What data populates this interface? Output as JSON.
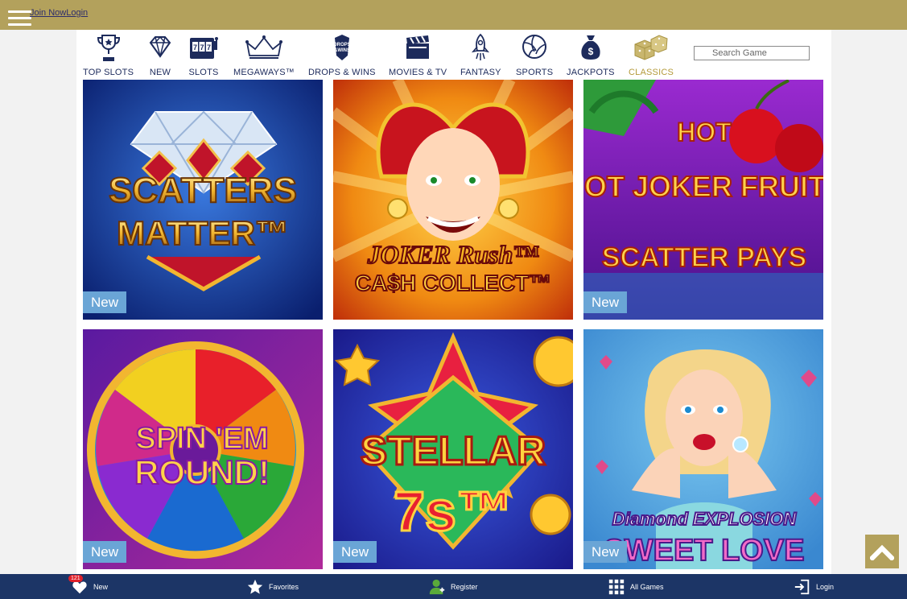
{
  "header": {
    "join_label": "Join Now",
    "login_label": "Login"
  },
  "categories": [
    {
      "label": "TOP SLOTS",
      "icon": "trophy-icon",
      "active": false
    },
    {
      "label": "NEW",
      "icon": "diamond-icon",
      "active": false
    },
    {
      "label": "SLOTS",
      "icon": "slot-machine-icon",
      "active": false
    },
    {
      "label": "MEGAWAYS™",
      "icon": "crown-icon",
      "active": false
    },
    {
      "label": "DROPS & WINS",
      "icon": "drops-wins-icon",
      "active": false
    },
    {
      "label": "MOVIES & TV",
      "icon": "clapperboard-icon",
      "active": false
    },
    {
      "label": "FANTASY",
      "icon": "rocket-icon",
      "active": false
    },
    {
      "label": "SPORTS",
      "icon": "volleyball-icon",
      "active": false
    },
    {
      "label": "JACKPOTS",
      "icon": "money-bag-icon",
      "active": false
    },
    {
      "label": "CLASSICS",
      "icon": "dice-icon",
      "active": true
    }
  ],
  "search": {
    "placeholder": "Search Game"
  },
  "games": [
    {
      "title_line1": "SCATTERS",
      "title_line2": "MATTER™",
      "badge": "New"
    },
    {
      "title_line1": "JOKER Rush™",
      "title_line2": "CA$H COLLECT™",
      "badge": ""
    },
    {
      "title_line1": "HOT JOKER FRUITS",
      "title_line2": "SCATTER PAYS",
      "badge": "New"
    },
    {
      "title_line1": "SPIN 'EM",
      "title_line2": "ROUND!",
      "badge": "New"
    },
    {
      "title_line1": "STELLAR",
      "title_line2": "7s™",
      "badge": "New"
    },
    {
      "title_line1": "Diamond EXPLOSION",
      "title_line2": "SWEET LOVE",
      "badge": "New"
    }
  ],
  "bottom_nav": [
    {
      "label": "New",
      "icon": "heart-tag-icon",
      "count": "121"
    },
    {
      "label": "Favorites",
      "icon": "star-icon"
    },
    {
      "label": "Register",
      "icon": "user-icon"
    },
    {
      "label": "All Games",
      "icon": "grid-icon"
    },
    {
      "label": "Login",
      "icon": "login-icon"
    }
  ],
  "colors": {
    "topbar": "#b3a15c",
    "nav_text": "#1d2b5c",
    "active_category": "#b49a3b",
    "bottom_bar": "#1c3566",
    "new_badge": "#6aa5d6"
  }
}
